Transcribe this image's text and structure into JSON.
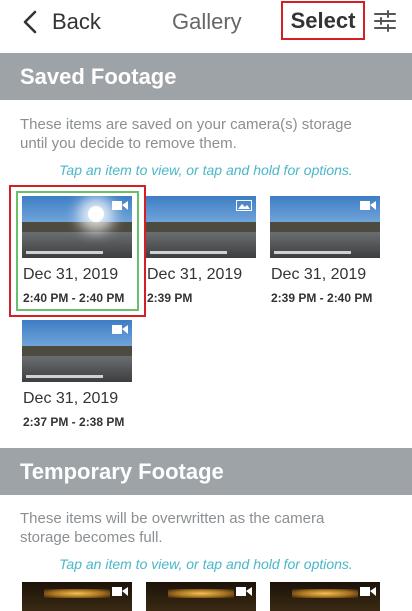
{
  "header": {
    "back_label": "Back",
    "title": "Gallery",
    "select_label": "Select",
    "back_icon": "chevron-left-icon",
    "filter_icon": "sliders-icon"
  },
  "saved": {
    "title": "Saved Footage",
    "description": "These items are saved on your camera(s) storage until you decide to remove them.",
    "hint": "Tap an item to view, or tap and hold for options.",
    "items": [
      {
        "date": "Dec 31, 2019",
        "time": "2:40 PM - 2:40 PM",
        "type": "video",
        "selected": true
      },
      {
        "date": "Dec 31, 2019",
        "time": "2:39 PM",
        "type": "photo",
        "selected": false
      },
      {
        "date": "Dec 31, 2019",
        "time": "2:39 PM - 2:40 PM",
        "type": "video",
        "selected": false
      },
      {
        "date": "Dec 31, 2019",
        "time": "2:37 PM - 2:38 PM",
        "type": "video",
        "selected": false
      }
    ]
  },
  "temporary": {
    "title": "Temporary Footage",
    "description": "These items will be overwritten as the camera storage becomes full.",
    "hint": "Tap an item to view, or tap and hold for options."
  },
  "colors": {
    "accent": "#4ab7c9",
    "highlight_red": "#d32027",
    "selected_green": "#6abf69",
    "section_bar": "#9ea3a7"
  }
}
